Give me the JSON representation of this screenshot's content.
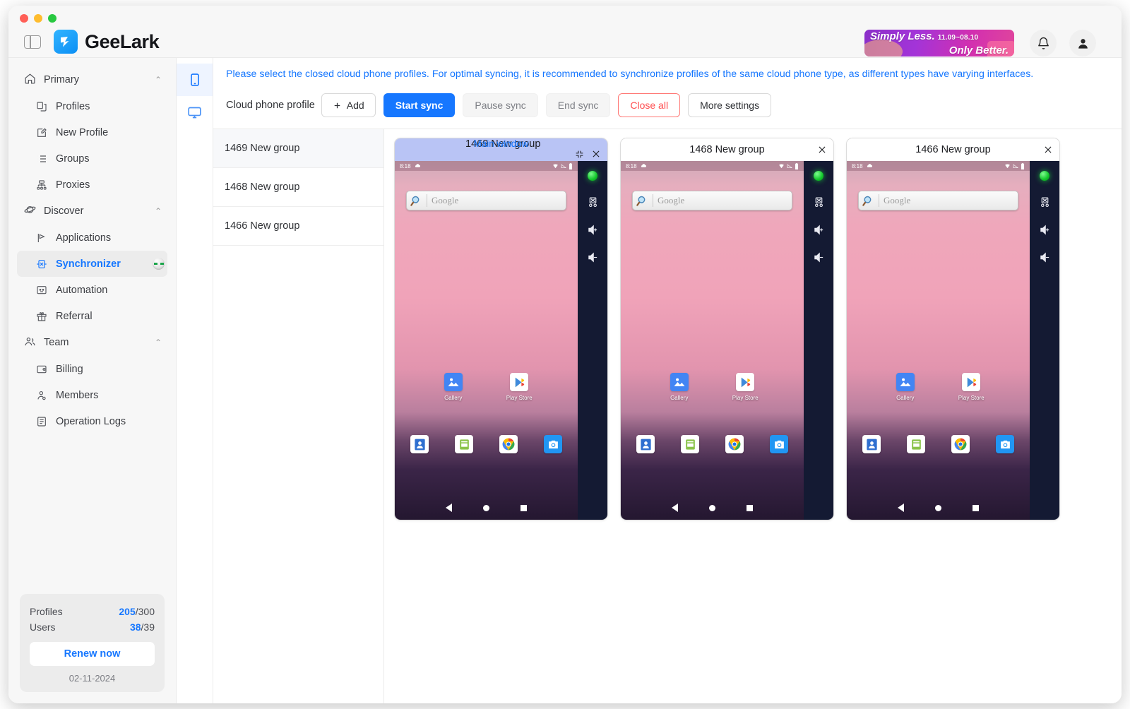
{
  "window": {
    "brand_name": "GeeLark",
    "traffic_lights": [
      "close",
      "minimize",
      "zoom"
    ],
    "panel_toggle_icon": "sidebar-toggle-icon",
    "logo_icon": "geelark-bird-logo"
  },
  "promo": {
    "line1": "Simply Less.",
    "date_range": "11.09~08.10",
    "line2": "Only Better."
  },
  "topbar": {
    "notification_icon": "bell-icon",
    "account_icon": "user-avatar-icon"
  },
  "sidebar": {
    "groups": [
      {
        "label": "Primary",
        "icon": "home-icon",
        "chevron": "⌃",
        "items": [
          {
            "label": "Profiles",
            "icon": "profiles-icon"
          },
          {
            "label": "New Profile",
            "icon": "new-profile-icon"
          },
          {
            "label": "Groups",
            "icon": "groups-list-icon"
          },
          {
            "label": "Proxies",
            "icon": "proxies-network-icon"
          }
        ]
      },
      {
        "label": "Discover",
        "icon": "discover-planet-icon",
        "chevron": "⌃",
        "items": [
          {
            "label": "Applications",
            "icon": "applications-icon"
          },
          {
            "label": "Synchronizer",
            "icon": "synchronizer-icon",
            "active": true,
            "badge": "new-badge"
          },
          {
            "label": "Automation",
            "icon": "automation-icon"
          },
          {
            "label": "Referral",
            "icon": "referral-gift-icon"
          }
        ]
      },
      {
        "label": "Team",
        "icon": "team-people-icon",
        "chevron": "⌃",
        "items": [
          {
            "label": "Billing",
            "icon": "billing-card-icon"
          },
          {
            "label": "Members",
            "icon": "members-icon"
          },
          {
            "label": "Operation Logs",
            "icon": "operation-logs-icon"
          }
        ]
      }
    ],
    "plan": {
      "profiles_label": "Profiles",
      "profiles_used": "205",
      "profiles_total": "/300",
      "users_label": "Users",
      "users_used": "38",
      "users_total": "/39",
      "renew_label": "Renew now",
      "expiry_date": "02-11-2024"
    }
  },
  "rail": {
    "items": [
      {
        "name": "cloud-phone-tab",
        "icon": "mobile-phone-icon",
        "active": true
      },
      {
        "name": "cloud-computer-tab",
        "icon": "desktop-monitor-icon",
        "active": false
      }
    ]
  },
  "main": {
    "notice": "Please select the closed cloud phone profiles. For optimal syncing, it is recommended to synchronize profiles of the same cloud phone type, as different types have varying interfaces.",
    "toolbar": {
      "label": "Cloud phone profile",
      "add_label": "Add",
      "add_icon": "plus-icon",
      "start_sync_label": "Start sync",
      "pause_sync_label": "Pause sync",
      "end_sync_label": "End sync",
      "close_all_label": "Close all",
      "more_settings_label": "More settings"
    },
    "profile_list": [
      {
        "label": "1469 New group",
        "selected": true
      },
      {
        "label": "1468 New group",
        "selected": false
      },
      {
        "label": "1466 New group",
        "selected": false
      }
    ],
    "phones": [
      {
        "main_tag": "Main window",
        "title": "1469 New group",
        "is_main": true,
        "collapse_icon": "collapse-arrows-icon",
        "close_icon": "close-x-icon"
      },
      {
        "main_tag": "",
        "title": "1468 New group",
        "is_main": false,
        "close_icon": "close-x-icon"
      },
      {
        "main_tag": "",
        "title": "1466 New group",
        "is_main": false,
        "close_icon": "close-x-icon"
      }
    ]
  },
  "phone_screen": {
    "status_time": "8:18",
    "status_left_icon": "cloud-icon",
    "status_right_icons": [
      "wifi-icon",
      "signal-icon",
      "battery-icon"
    ],
    "search_placeholder": "Google",
    "search_icon": "magnifier-icon",
    "apps": [
      {
        "label": "Gallery",
        "icon": "gallery-icon"
      },
      {
        "label": "Play Store",
        "icon": "play-store-icon"
      }
    ],
    "dock": [
      {
        "name": "contacts-icon"
      },
      {
        "name": "messages-icon"
      },
      {
        "name": "chrome-icon"
      },
      {
        "name": "camera-icon"
      }
    ],
    "navbar": [
      "back-triangle-icon",
      "home-circle-icon",
      "recents-square-icon"
    ],
    "side_controls": [
      {
        "name": "status-led",
        "icon": "green-led-icon"
      },
      {
        "name": "screenshot-button",
        "icon": "screenshot-scissors-icon"
      },
      {
        "name": "volume-up-button",
        "icon": "volume-up-icon"
      },
      {
        "name": "volume-down-button",
        "icon": "volume-down-icon"
      }
    ]
  },
  "colors": {
    "accent": "#1677ff",
    "danger": "#ff4d4f",
    "main_window_header": "#b9c4f5",
    "sidebar_bg": "#f7f7f7"
  }
}
